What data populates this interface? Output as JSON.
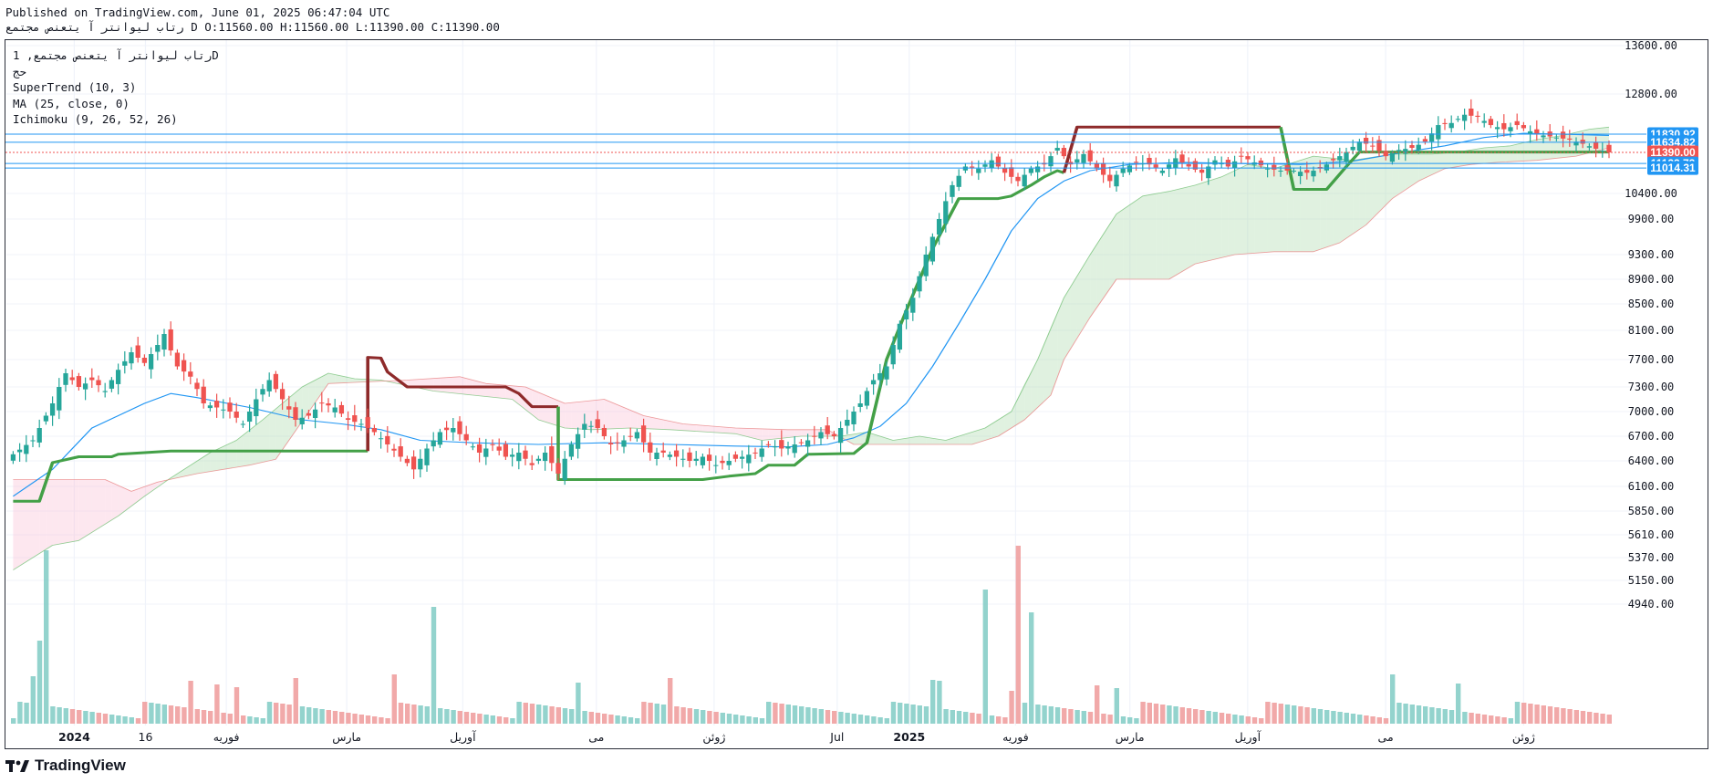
{
  "header": {
    "published_line": "Published on TradingView.com, June 01, 2025 06:47:04 UTC",
    "symbol_line": "رتاب لیوانتر آ یتعنص مجتمع D O:11560.00 H:11560.00 L:11390.00 C:11390.00"
  },
  "legend": {
    "symbol": "رتاب لیوانتر آ یتعنص مجتمع, 1D",
    "volume": "حج",
    "supertrend": "SuperTrend (10, 3)",
    "ma": "MA (25, close, 0)",
    "ichimoku": "Ichimoku (9, 26, 52, 26)"
  },
  "footer": {
    "brand": "TradingView"
  },
  "colors": {
    "up": "#26a69a",
    "down": "#ef5350",
    "supertrend_up": "#43a047",
    "supertrend_down": "#8e2a2a",
    "ma": "#2196f3",
    "level_line": "#2196f3",
    "last_price": "#ef5350",
    "cloud_bull": "#a5d6a7",
    "cloud_bear": "#f8bbd0"
  },
  "chart_data": {
    "type": "candlestick",
    "title": "رتاب لیوانتر آ یتعنص مجتمع, 1D",
    "x_tick_labels": [
      "2024",
      "16",
      "فوریه",
      "مارس",
      "آوریل",
      "می",
      "ژوئن",
      "Jul",
      "2025",
      "فوریه",
      "مارس",
      "آوریل",
      "می",
      "ژوئن"
    ],
    "y_tick_labels": [
      "13600.00",
      "12800.00",
      "10400.00",
      "9900.00",
      "9300.00",
      "8900.00",
      "8500.00",
      "8100.00",
      "7700.00",
      "7300.00",
      "7000.00",
      "6700.00",
      "6400.00",
      "6100.00",
      "5850.00",
      "5610.00",
      "5370.00",
      "5150.00",
      "4940.00"
    ],
    "price_scale": "log",
    "price_levels": [
      {
        "value": "11830.92",
        "color": "#2196f3"
      },
      {
        "value": "11634.82",
        "color": "#2196f3"
      },
      {
        "value": "11390.00",
        "color": "#ef5350"
      },
      {
        "value": "11122.72",
        "color": "#2196f3"
      },
      {
        "value": "11014.31",
        "color": "#2196f3"
      }
    ],
    "last_close": 11390,
    "ohlc_last": {
      "open": 11560,
      "high": 11560,
      "low": 11390,
      "close": 11390
    },
    "price_path": [
      [
        0,
        6480
      ],
      [
        3,
        6650
      ],
      [
        6,
        7100
      ],
      [
        8,
        7500
      ],
      [
        10,
        7300
      ],
      [
        12,
        7400
      ],
      [
        14,
        7250
      ],
      [
        16,
        7550
      ],
      [
        18,
        7800
      ],
      [
        20,
        7650
      ],
      [
        22,
        7900
      ],
      [
        23,
        8050
      ],
      [
        25,
        7600
      ],
      [
        27,
        7450
      ],
      [
        29,
        7100
      ],
      [
        31,
        7050
      ],
      [
        33,
        7000
      ],
      [
        35,
        6850
      ],
      [
        37,
        7150
      ],
      [
        39,
        7400
      ],
      [
        41,
        7150
      ],
      [
        43,
        6900
      ],
      [
        45,
        6950
      ],
      [
        47,
        7100
      ],
      [
        49,
        7050
      ],
      [
        51,
        6900
      ],
      [
        53,
        6850
      ],
      [
        55,
        6750
      ],
      [
        57,
        6600
      ],
      [
        59,
        6450
      ],
      [
        61,
        6300
      ],
      [
        63,
        6550
      ],
      [
        65,
        6750
      ],
      [
        67,
        6800
      ],
      [
        69,
        6650
      ],
      [
        71,
        6500
      ],
      [
        73,
        6600
      ],
      [
        75,
        6450
      ],
      [
        77,
        6500
      ],
      [
        79,
        6350
      ],
      [
        81,
        6500
      ],
      [
        83,
        6250
      ],
      [
        85,
        6600
      ],
      [
        87,
        6850
      ],
      [
        89,
        6800
      ],
      [
        91,
        6600
      ],
      [
        93,
        6650
      ],
      [
        95,
        6750
      ],
      [
        97,
        6500
      ],
      [
        99,
        6500
      ],
      [
        101,
        6450
      ],
      [
        103,
        6400
      ],
      [
        105,
        6450
      ],
      [
        107,
        6350
      ],
      [
        109,
        6400
      ],
      [
        111,
        6450
      ],
      [
        113,
        6500
      ],
      [
        115,
        6600
      ],
      [
        117,
        6550
      ],
      [
        119,
        6600
      ],
      [
        121,
        6650
      ],
      [
        123,
        6750
      ],
      [
        125,
        6700
      ],
      [
        127,
        6900
      ],
      [
        129,
        7100
      ],
      [
        131,
        7400
      ],
      [
        133,
        7600
      ],
      [
        135,
        8200
      ],
      [
        137,
        8600
      ],
      [
        139,
        9300
      ],
      [
        141,
        9900
      ],
      [
        143,
        10600
      ],
      [
        145,
        11050
      ],
      [
        147,
        11000
      ],
      [
        149,
        11200
      ],
      [
        151,
        10900
      ],
      [
        153,
        10700
      ],
      [
        155,
        11000
      ],
      [
        157,
        11100
      ],
      [
        159,
        11500
      ],
      [
        161,
        11100
      ],
      [
        163,
        11350
      ],
      [
        165,
        11000
      ],
      [
        167,
        10700
      ],
      [
        169,
        11000
      ],
      [
        171,
        11150
      ],
      [
        173,
        11100
      ],
      [
        175,
        10950
      ],
      [
        177,
        11250
      ],
      [
        179,
        11050
      ],
      [
        181,
        10900
      ],
      [
        183,
        11200
      ],
      [
        185,
        11050
      ],
      [
        187,
        11300
      ],
      [
        189,
        11150
      ],
      [
        191,
        11000
      ],
      [
        193,
        10950
      ],
      [
        195,
        10950
      ],
      [
        197,
        10900
      ],
      [
        199,
        11000
      ],
      [
        201,
        11200
      ],
      [
        203,
        11400
      ],
      [
        205,
        11650
      ],
      [
        207,
        11550
      ],
      [
        209,
        11300
      ],
      [
        211,
        11450
      ],
      [
        213,
        11500
      ],
      [
        215,
        11650
      ],
      [
        217,
        12050
      ],
      [
        219,
        12100
      ],
      [
        221,
        12300
      ],
      [
        223,
        12250
      ],
      [
        225,
        12050
      ],
      [
        227,
        11950
      ],
      [
        229,
        12050
      ],
      [
        231,
        11900
      ],
      [
        233,
        11800
      ],
      [
        235,
        11750
      ],
      [
        237,
        11700
      ],
      [
        239,
        11600
      ],
      [
        241,
        11480
      ],
      [
        243,
        11390
      ]
    ],
    "ma_path": [
      [
        0,
        6000
      ],
      [
        6,
        6300
      ],
      [
        12,
        6800
      ],
      [
        20,
        7100
      ],
      [
        24,
        7220
      ],
      [
        28,
        7170
      ],
      [
        36,
        7050
      ],
      [
        44,
        6900
      ],
      [
        50,
        6850
      ],
      [
        56,
        6780
      ],
      [
        62,
        6650
      ],
      [
        70,
        6620
      ],
      [
        80,
        6600
      ],
      [
        90,
        6620
      ],
      [
        100,
        6600
      ],
      [
        110,
        6580
      ],
      [
        118,
        6570
      ],
      [
        124,
        6600
      ],
      [
        128,
        6680
      ],
      [
        132,
        6820
      ],
      [
        136,
        7100
      ],
      [
        140,
        7600
      ],
      [
        144,
        8200
      ],
      [
        148,
        8900
      ],
      [
        152,
        9700
      ],
      [
        156,
        10300
      ],
      [
        160,
        10700
      ],
      [
        164,
        10950
      ],
      [
        170,
        11100
      ],
      [
        178,
        11150
      ],
      [
        188,
        11120
      ],
      [
        196,
        11100
      ],
      [
        204,
        11180
      ],
      [
        212,
        11400
      ],
      [
        218,
        11550
      ],
      [
        224,
        11750
      ],
      [
        230,
        11850
      ],
      [
        236,
        11830
      ],
      [
        243,
        11800
      ]
    ],
    "supertrend_path": [
      [
        0,
        5950
      ],
      [
        4,
        5950
      ],
      [
        6,
        6380
      ],
      [
        10,
        6450
      ],
      [
        15,
        6450
      ],
      [
        16,
        6480
      ],
      [
        24,
        6520
      ],
      [
        54,
        6520
      ],
      [
        54,
        7730
      ],
      [
        56,
        7720
      ],
      [
        57,
        7520
      ],
      [
        60,
        7300
      ],
      [
        75,
        7300
      ],
      [
        77,
        7220
      ],
      [
        79,
        7060
      ],
      [
        83,
        7060
      ],
      [
        83,
        6180
      ],
      [
        105,
        6180
      ],
      [
        109,
        6220
      ],
      [
        113,
        6250
      ],
      [
        115,
        6350
      ],
      [
        119,
        6350
      ],
      [
        121,
        6480
      ],
      [
        128,
        6490
      ],
      [
        130,
        6620
      ],
      [
        133,
        7700
      ],
      [
        136,
        8400
      ],
      [
        140,
        9400
      ],
      [
        144,
        10300
      ],
      [
        150,
        10300
      ],
      [
        152,
        10350
      ],
      [
        155,
        10600
      ],
      [
        157,
        10800
      ],
      [
        159,
        10950
      ],
      [
        160,
        10900
      ],
      [
        162,
        12000
      ],
      [
        193,
        12000
      ],
      [
        195,
        10500
      ],
      [
        200,
        10500
      ],
      [
        203,
        11050
      ],
      [
        205,
        11400
      ],
      [
        243,
        11400
      ]
    ],
    "ichimoku_span_a": [
      [
        0,
        5250
      ],
      [
        6,
        5500
      ],
      [
        10,
        5550
      ],
      [
        16,
        5800
      ],
      [
        20,
        6000
      ],
      [
        24,
        6200
      ],
      [
        30,
        6500
      ],
      [
        34,
        6650
      ],
      [
        38,
        6900
      ],
      [
        44,
        7300
      ],
      [
        48,
        7500
      ],
      [
        52,
        7420
      ],
      [
        56,
        7400
      ],
      [
        60,
        7320
      ],
      [
        64,
        7250
      ],
      [
        70,
        7200
      ],
      [
        76,
        7150
      ],
      [
        80,
        6900
      ],
      [
        84,
        6800
      ],
      [
        88,
        6780
      ],
      [
        94,
        6800
      ],
      [
        100,
        6780
      ],
      [
        106,
        6750
      ],
      [
        110,
        6730
      ],
      [
        114,
        6650
      ],
      [
        120,
        6700
      ],
      [
        126,
        6700
      ],
      [
        130,
        6750
      ],
      [
        134,
        6650
      ],
      [
        138,
        6700
      ],
      [
        142,
        6650
      ],
      [
        148,
        6800
      ],
      [
        150,
        6900
      ],
      [
        152,
        7000
      ],
      [
        156,
        7700
      ],
      [
        160,
        8600
      ],
      [
        164,
        9300
      ],
      [
        168,
        10000
      ],
      [
        172,
        10350
      ],
      [
        176,
        10450
      ],
      [
        180,
        10600
      ],
      [
        184,
        10800
      ],
      [
        188,
        11100
      ],
      [
        192,
        11000
      ],
      [
        198,
        11300
      ],
      [
        204,
        11200
      ],
      [
        210,
        11350
      ],
      [
        216,
        11350
      ],
      [
        220,
        11400
      ],
      [
        224,
        11500
      ],
      [
        228,
        11550
      ],
      [
        232,
        11700
      ],
      [
        236,
        11800
      ],
      [
        240,
        11950
      ],
      [
        243,
        12000
      ]
    ],
    "ichimoku_span_b": [
      [
        0,
        6180
      ],
      [
        8,
        6180
      ],
      [
        14,
        6180
      ],
      [
        18,
        6050
      ],
      [
        22,
        6150
      ],
      [
        28,
        6250
      ],
      [
        36,
        6350
      ],
      [
        40,
        6420
      ],
      [
        48,
        7350
      ],
      [
        60,
        7400
      ],
      [
        68,
        7450
      ],
      [
        72,
        7350
      ],
      [
        78,
        7300
      ],
      [
        84,
        7100
      ],
      [
        90,
        7150
      ],
      [
        96,
        6950
      ],
      [
        102,
        6850
      ],
      [
        110,
        6800
      ],
      [
        118,
        6780
      ],
      [
        124,
        6780
      ],
      [
        128,
        6600
      ],
      [
        132,
        6600
      ],
      [
        140,
        6600
      ],
      [
        146,
        6600
      ],
      [
        150,
        6700
      ],
      [
        154,
        6900
      ],
      [
        158,
        7200
      ],
      [
        160,
        7700
      ],
      [
        164,
        8300
      ],
      [
        168,
        8900
      ],
      [
        176,
        8900
      ],
      [
        180,
        9150
      ],
      [
        186,
        9300
      ],
      [
        192,
        9350
      ],
      [
        198,
        9350
      ],
      [
        202,
        9500
      ],
      [
        206,
        9800
      ],
      [
        210,
        10300
      ],
      [
        214,
        10700
      ],
      [
        218,
        11000
      ],
      [
        222,
        11100
      ],
      [
        226,
        11150
      ],
      [
        232,
        11200
      ],
      [
        238,
        11300
      ],
      [
        243,
        11500
      ]
    ],
    "volume_scale_note": "relative"
  }
}
